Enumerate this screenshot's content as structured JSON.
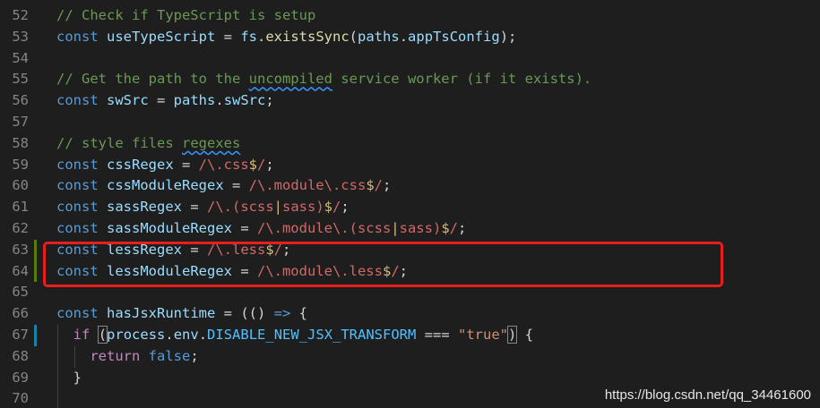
{
  "editor": {
    "lines": [
      {
        "n": "52",
        "segs": [
          {
            "t": "// Check if TypeScript is setup",
            "c": "cm"
          }
        ]
      },
      {
        "n": "53",
        "segs": [
          {
            "t": "const ",
            "c": "kw"
          },
          {
            "t": "useTypeScript",
            "c": "var"
          },
          {
            "t": " = ",
            "c": "op"
          },
          {
            "t": "fs",
            "c": "var"
          },
          {
            "t": ".",
            "c": "op"
          },
          {
            "t": "existsSync",
            "c": "fn"
          },
          {
            "t": "(",
            "c": "op"
          },
          {
            "t": "paths",
            "c": "var"
          },
          {
            "t": ".",
            "c": "op"
          },
          {
            "t": "appTsConfig",
            "c": "var"
          },
          {
            "t": ");",
            "c": "op"
          }
        ]
      },
      {
        "n": "54",
        "segs": []
      },
      {
        "n": "55",
        "segs": [
          {
            "t": "// Get the path to the ",
            "c": "cm"
          },
          {
            "t": "uncompiled",
            "c": "cm squig"
          },
          {
            "t": " service worker (if it exists).",
            "c": "cm"
          }
        ]
      },
      {
        "n": "56",
        "segs": [
          {
            "t": "const ",
            "c": "kw"
          },
          {
            "t": "swSrc",
            "c": "var"
          },
          {
            "t": " = ",
            "c": "op"
          },
          {
            "t": "paths",
            "c": "var"
          },
          {
            "t": ".",
            "c": "op"
          },
          {
            "t": "swSrc",
            "c": "var"
          },
          {
            "t": ";",
            "c": "op"
          }
        ]
      },
      {
        "n": "57",
        "segs": []
      },
      {
        "n": "58",
        "segs": [
          {
            "t": "// style files ",
            "c": "cm"
          },
          {
            "t": "regexes",
            "c": "cm squig"
          }
        ]
      },
      {
        "n": "59",
        "segs": [
          {
            "t": "const ",
            "c": "kw"
          },
          {
            "t": "cssRegex",
            "c": "var"
          },
          {
            "t": " = ",
            "c": "op"
          },
          {
            "t": "/\\.",
            "c": "re"
          },
          {
            "t": "css",
            "c": "re"
          },
          {
            "t": "$",
            "c": "rec"
          },
          {
            "t": "/",
            "c": "re"
          },
          {
            "t": ";",
            "c": "op"
          }
        ]
      },
      {
        "n": "60",
        "segs": [
          {
            "t": "const ",
            "c": "kw"
          },
          {
            "t": "cssModuleRegex",
            "c": "var"
          },
          {
            "t": " = ",
            "c": "op"
          },
          {
            "t": "/\\.module\\.css",
            "c": "re"
          },
          {
            "t": "$",
            "c": "rec"
          },
          {
            "t": "/",
            "c": "re"
          },
          {
            "t": ";",
            "c": "op"
          }
        ]
      },
      {
        "n": "61",
        "segs": [
          {
            "t": "const ",
            "c": "kw"
          },
          {
            "t": "sassRegex",
            "c": "var"
          },
          {
            "t": " = ",
            "c": "op"
          },
          {
            "t": "/\\.(scss",
            "c": "re"
          },
          {
            "t": "|",
            "c": "rec"
          },
          {
            "t": "sass)",
            "c": "re"
          },
          {
            "t": "$",
            "c": "rec"
          },
          {
            "t": "/",
            "c": "re"
          },
          {
            "t": ";",
            "c": "op"
          }
        ]
      },
      {
        "n": "62",
        "segs": [
          {
            "t": "const ",
            "c": "kw"
          },
          {
            "t": "sassModuleRegex",
            "c": "var"
          },
          {
            "t": " = ",
            "c": "op"
          },
          {
            "t": "/\\.module\\.(scss",
            "c": "re"
          },
          {
            "t": "|",
            "c": "rec"
          },
          {
            "t": "sass)",
            "c": "re"
          },
          {
            "t": "$",
            "c": "rec"
          },
          {
            "t": "/",
            "c": "re"
          },
          {
            "t": ";",
            "c": "op"
          }
        ]
      },
      {
        "n": "63",
        "segs": [
          {
            "t": "const ",
            "c": "kw"
          },
          {
            "t": "lessRegex",
            "c": "var"
          },
          {
            "t": " = ",
            "c": "op"
          },
          {
            "t": "/\\.less",
            "c": "re"
          },
          {
            "t": "$",
            "c": "rec"
          },
          {
            "t": "/",
            "c": "re"
          },
          {
            "t": ";",
            "c": "op"
          }
        ]
      },
      {
        "n": "64",
        "segs": [
          {
            "t": "const ",
            "c": "kw"
          },
          {
            "t": "lessModuleRegex",
            "c": "var"
          },
          {
            "t": " = ",
            "c": "op"
          },
          {
            "t": "/\\.module\\.less",
            "c": "re"
          },
          {
            "t": "$",
            "c": "rec"
          },
          {
            "t": "/",
            "c": "re"
          },
          {
            "t": ";",
            "c": "op"
          }
        ]
      },
      {
        "n": "65",
        "segs": []
      },
      {
        "n": "66",
        "segs": [
          {
            "t": "const ",
            "c": "kw"
          },
          {
            "t": "hasJsxRuntime",
            "c": "var"
          },
          {
            "t": " = (() ",
            "c": "op"
          },
          {
            "t": "=>",
            "c": "kw"
          },
          {
            "t": " {",
            "c": "op"
          }
        ]
      },
      {
        "n": "67",
        "segs": [
          {
            "t": "  ",
            "c": "op"
          },
          {
            "t": "if",
            "c": "ctl"
          },
          {
            "t": " ",
            "c": "op"
          },
          {
            "t": "(",
            "c": "op bracket-match"
          },
          {
            "t": "process",
            "c": "var"
          },
          {
            "t": ".",
            "c": "op"
          },
          {
            "t": "env",
            "c": "var"
          },
          {
            "t": ".",
            "c": "op"
          },
          {
            "t": "DISABLE_NEW_JSX_TRANSFORM",
            "c": "const"
          },
          {
            "t": " === ",
            "c": "op"
          },
          {
            "t": "\"true\"",
            "c": "str"
          },
          {
            "t": ")",
            "c": "op bracket-match"
          },
          {
            "t": " {",
            "c": "op"
          }
        ]
      },
      {
        "n": "68",
        "segs": [
          {
            "t": "    ",
            "c": "op"
          },
          {
            "t": "return",
            "c": "ctl"
          },
          {
            "t": " ",
            "c": "op"
          },
          {
            "t": "false",
            "c": "kw"
          },
          {
            "t": ";",
            "c": "op"
          }
        ]
      },
      {
        "n": "69",
        "segs": [
          {
            "t": "  }",
            "c": "op"
          }
        ]
      },
      {
        "n": "70",
        "segs": []
      }
    ],
    "modified_lines": [
      "63",
      "64",
      "67"
    ]
  },
  "watermark": "https://blog.csdn.net/qq_34461600",
  "colors": {
    "highlight_box": "#e81e1e",
    "gutter_modified": "#587c0c",
    "gutter_modified_blue": "#1b81a8"
  }
}
